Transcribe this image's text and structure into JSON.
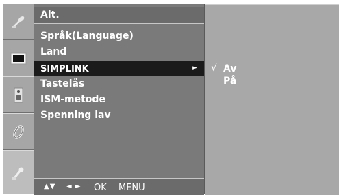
{
  "menu": {
    "title": "Alt.",
    "items": [
      {
        "label": "Språk(Language)"
      },
      {
        "label": "Land"
      },
      {
        "label": "SIMPLINK",
        "arrow": "►"
      },
      {
        "label": "Tastelås"
      },
      {
        "label": "ISM-metode"
      },
      {
        "label": "Spenning lav"
      }
    ],
    "selected_index": 2
  },
  "submenu": {
    "options": [
      {
        "check": "√",
        "label": "Av"
      },
      {
        "check": "",
        "label": "På"
      }
    ]
  },
  "hint": {
    "updown": "▲▼",
    "leftright": "◄ ►",
    "ok": "OK",
    "menu": "MENU"
  },
  "rail": {
    "icons": [
      "satellite-dish-icon",
      "picture-icon",
      "speaker-icon",
      "clock-icon",
      "tools-icon"
    ],
    "active_icon": "tools-icon"
  },
  "colors": {
    "menu_bg": "#7a7a7a",
    "selected_bg": "#1b1b1b",
    "submenu_bg": "#a8a8a8",
    "rail_bg": "#a6a6a6",
    "text": "#ffffff"
  }
}
